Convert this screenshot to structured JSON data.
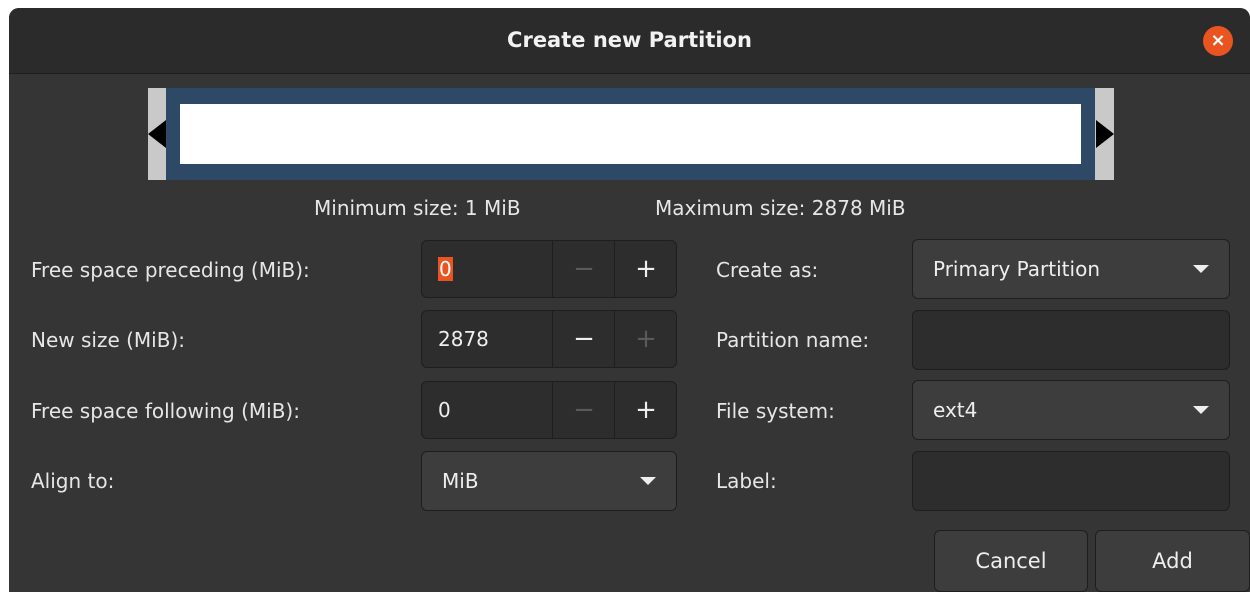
{
  "window": {
    "title": "Create new Partition"
  },
  "size_info": {
    "minimum": "Minimum size: 1 MiB",
    "maximum": "Maximum size: 2878 MiB"
  },
  "left_form": {
    "free_preceding": {
      "label": "Free space preceding (MiB):",
      "value": "0"
    },
    "new_size": {
      "label": "New size (MiB):",
      "value": "2878"
    },
    "free_following": {
      "label": "Free space following (MiB):",
      "value": "0"
    },
    "align_to": {
      "label": "Align to:",
      "value": "MiB"
    }
  },
  "right_form": {
    "create_as": {
      "label": "Create as:",
      "value": "Primary Partition"
    },
    "partition_name": {
      "label": "Partition name:",
      "value": ""
    },
    "file_system": {
      "label": "File system:",
      "value": "ext4"
    },
    "label": {
      "label": "Label:",
      "value": ""
    }
  },
  "spin_glyphs": {
    "minus": "−",
    "plus": "+"
  },
  "close_glyph": "×",
  "buttons": {
    "cancel": "Cancel",
    "add": "Add"
  },
  "colors": {
    "accent": "#e95420",
    "partition_frame": "#2d4966",
    "background": "#353535"
  }
}
